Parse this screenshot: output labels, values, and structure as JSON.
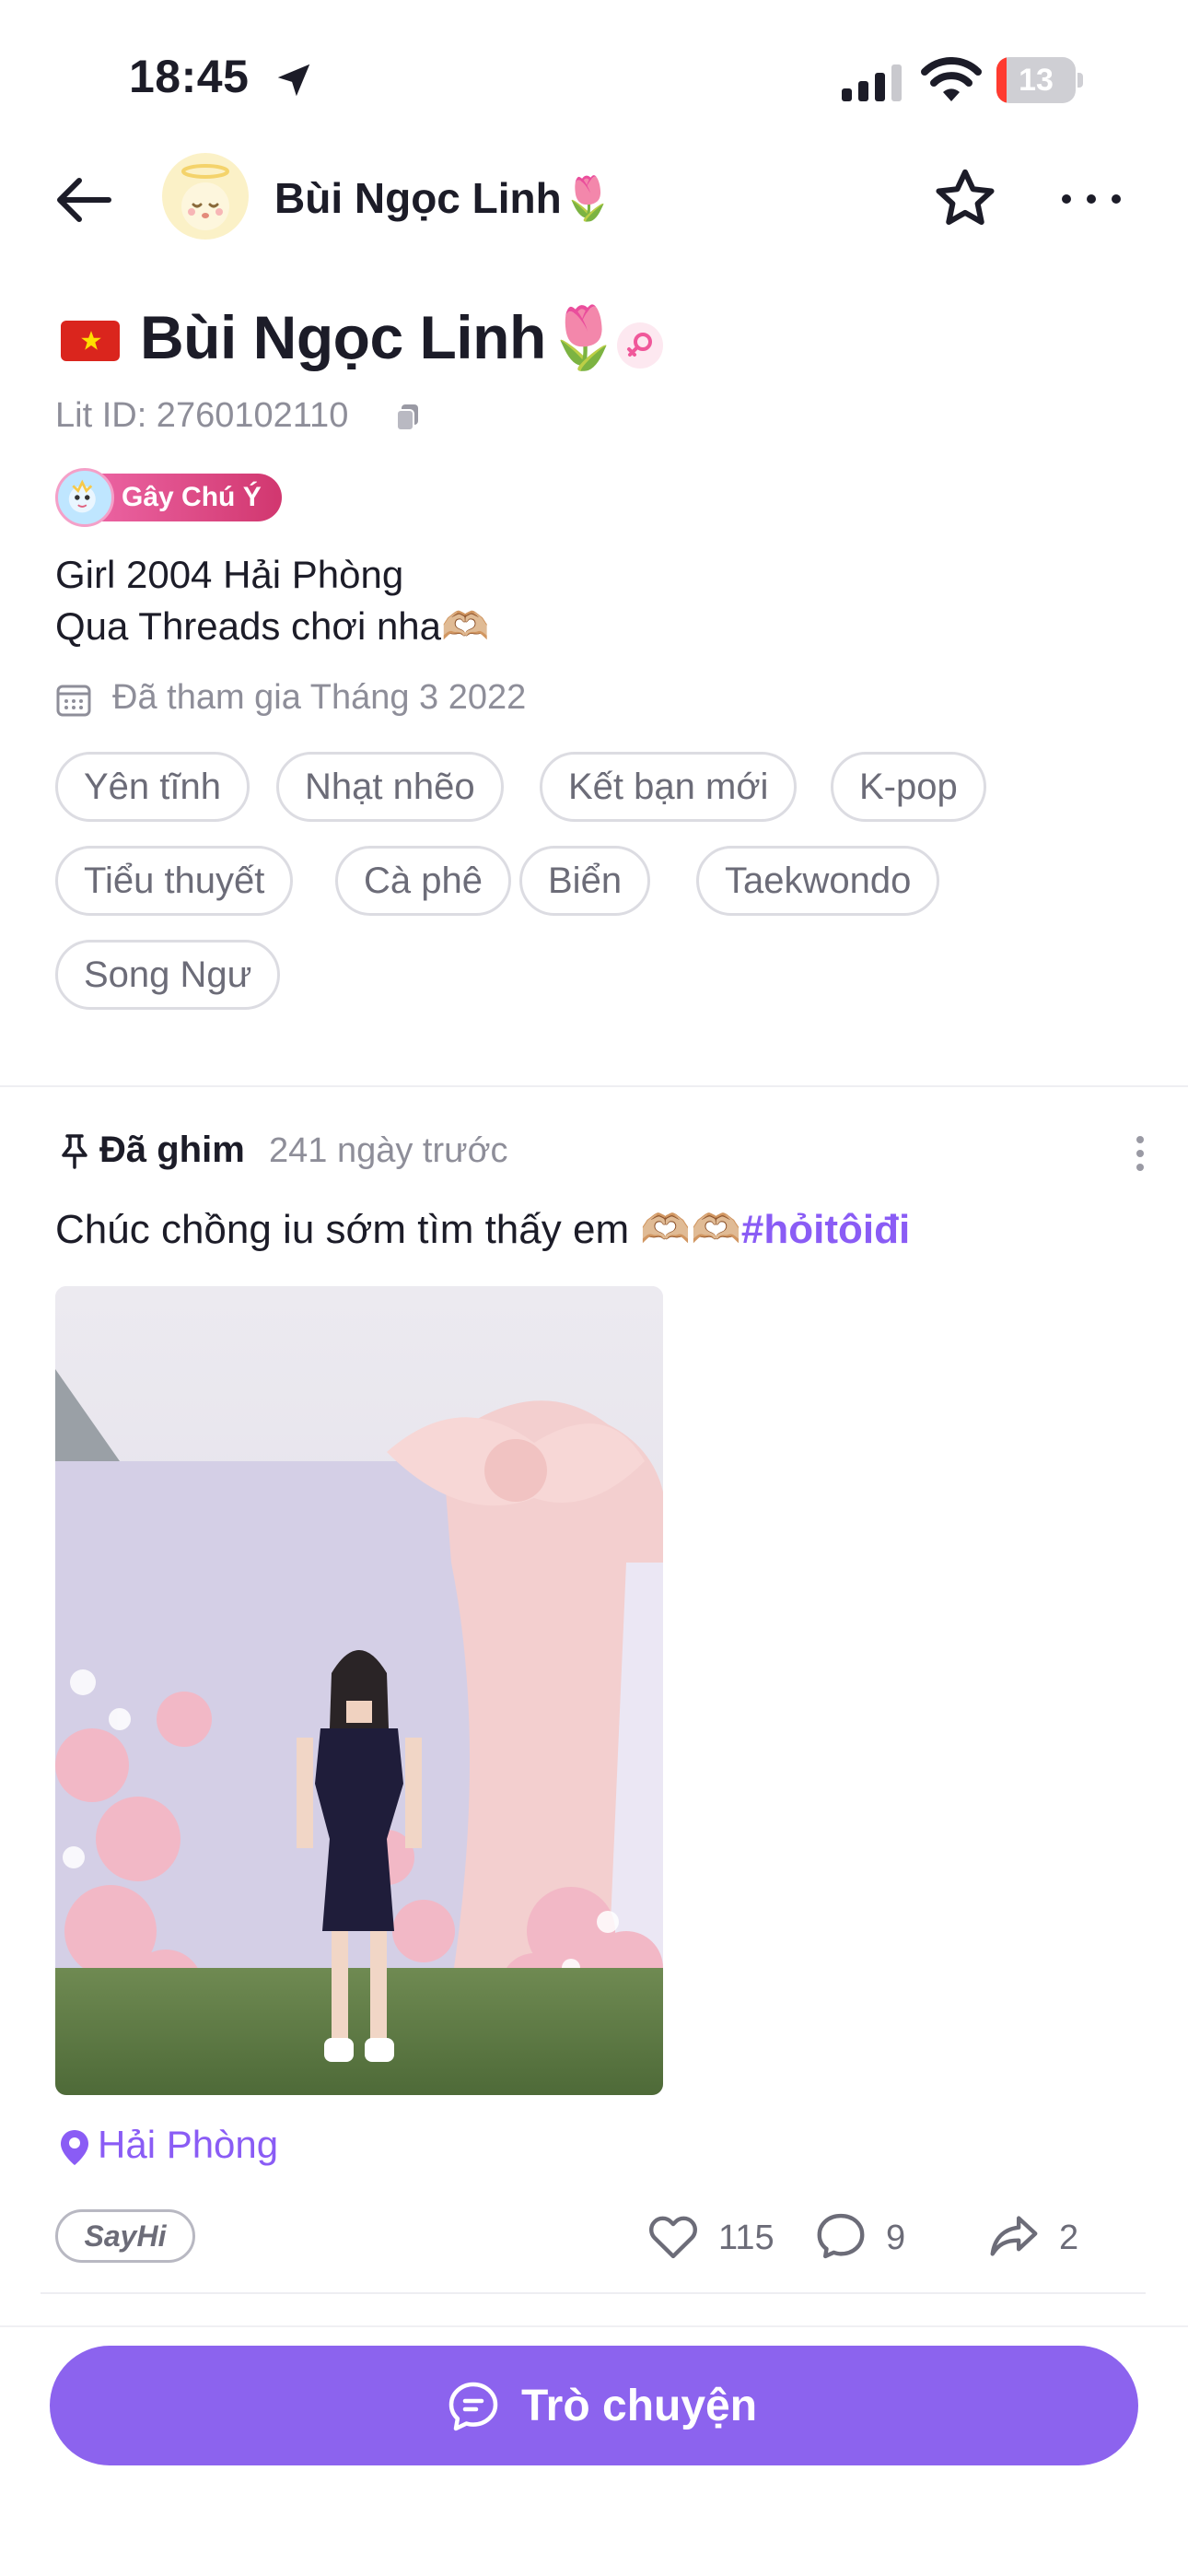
{
  "status_bar": {
    "time": "18:45",
    "battery": "13",
    "battery_level": 0.13
  },
  "nav": {
    "title": "Bùi Ngọc Linh🌷"
  },
  "profile": {
    "name": "Bùi Ngọc Linh🌷",
    "lit_id": "Lit ID: 2760102110",
    "badge": "Gây Chú Ý",
    "bio": "Girl 2004 Hải Phòng\nQua Threads chơi nha🫶🏼",
    "joined": "Đã tham gia Tháng 3 2022",
    "tags": [
      "Yên tĩnh",
      "Nhạt nhẽo",
      "Kết bạn mới",
      "K-pop",
      "Tiểu thuyết",
      "Cà phê",
      "Biển",
      "Taekwondo",
      "Song Ngư"
    ]
  },
  "post": {
    "pinned_label": "Đã ghim",
    "time": "241 ngày trước",
    "text": "Chúc chồng iu sớm tìm thấy em 🫶🏼🫶🏼",
    "hashtag": "#hỏitôiđi",
    "location": "Hải Phòng",
    "sayhi_label": "SayHi",
    "likes": "115",
    "comments": "9",
    "shares": "2"
  },
  "chat_button": {
    "label": "Trò chuyện"
  },
  "colors": {
    "accent": "#8c63ee",
    "hashtag": "#8a5cf5",
    "muted_text": "#8e8e99",
    "badge_gradient_start": "#f06bab",
    "badge_gradient_end": "#d1376f"
  }
}
